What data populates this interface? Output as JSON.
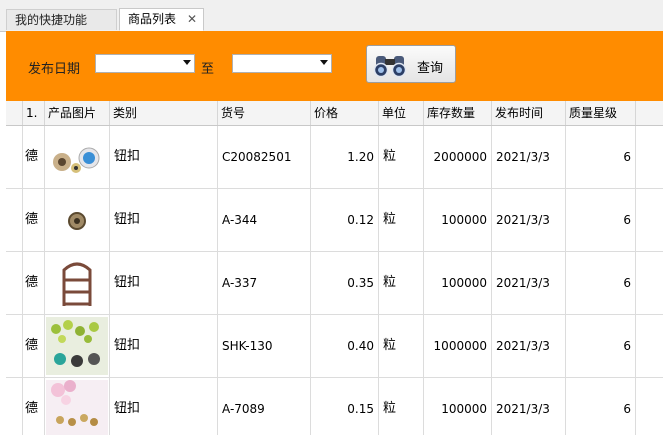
{
  "tabs": [
    {
      "label": "我的快捷功能",
      "active": false
    },
    {
      "label": "商品列表",
      "active": true
    }
  ],
  "tab_close": "✕",
  "search": {
    "date_label": "发布日期",
    "to_label": "至",
    "start_value": "",
    "end_value": "",
    "query_label": "查询"
  },
  "columns": [
    "1.",
    "产品图片",
    "类别",
    "货号",
    "价格",
    "单位",
    "库存数量",
    "发布时间",
    "质量星级"
  ],
  "rows": [
    {
      "mark": "德",
      "image": "button-product-image",
      "category": "钮扣",
      "sku": "C20082501",
      "price": "1.20",
      "unit": "粒",
      "stock": "2000000",
      "date": "2021/3/3",
      "stars": "6"
    },
    {
      "mark": "德",
      "image": "button-product-image",
      "category": "钮扣",
      "sku": "A-344",
      "price": "0.12",
      "unit": "粒",
      "stock": "100000",
      "date": "2021/3/3",
      "stars": "6"
    },
    {
      "mark": "德",
      "image": "button-product-image",
      "category": "钮扣",
      "sku": "A-337",
      "price": "0.35",
      "unit": "粒",
      "stock": "100000",
      "date": "2021/3/3",
      "stars": "6"
    },
    {
      "mark": "德",
      "image": "button-product-image",
      "category": "钮扣",
      "sku": "SHK-130",
      "price": "0.40",
      "unit": "粒",
      "stock": "1000000",
      "date": "2021/3/3",
      "stars": "6"
    },
    {
      "mark": "德",
      "image": "button-product-image",
      "category": "钮扣",
      "sku": "A-7089",
      "price": "0.15",
      "unit": "粒",
      "stock": "100000",
      "date": "2021/3/3",
      "stars": "6"
    }
  ],
  "colors": {
    "accent": "#ff8c00",
    "header_bg": "#f4f4f4",
    "grid_line": "#dcdcdc"
  }
}
